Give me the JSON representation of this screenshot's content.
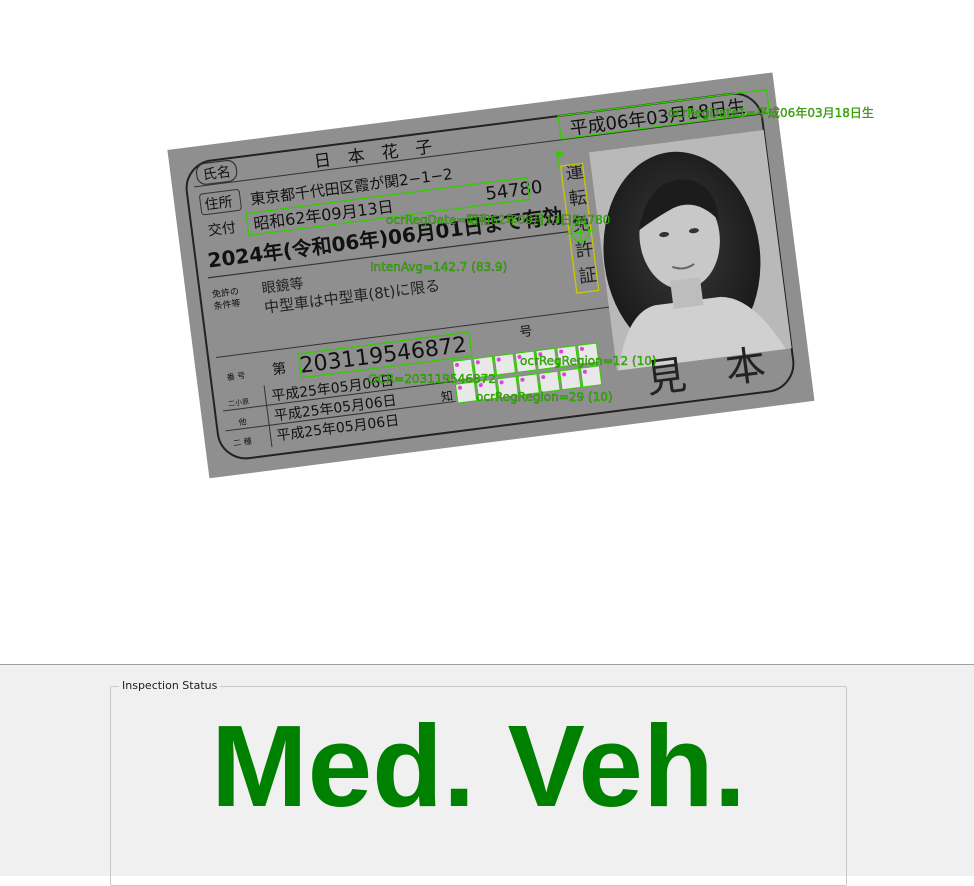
{
  "license": {
    "name_label": "氏名",
    "name_value": "日　本　花　子",
    "birth_date": "平成06年03月18日生",
    "address_label": "住所",
    "address_value": "東京都千代田区霞が関2−1−2",
    "issue_label": "交付",
    "issue_date": "昭和62年09月13日",
    "issue_number": "54780",
    "expiry": "2024年(令和06年)06月01日まで有効",
    "conditions_label_1": "免許の",
    "conditions_label_2": "条件等",
    "conditions_1": "眼鏡等",
    "conditions_2": "中型車は中型車(8t)に限る",
    "number_label": "番 号",
    "number_prefix": "第",
    "license_number": "203119546872",
    "number_suffix": "号",
    "category_labels": [
      "二小原",
      "他",
      "二 種"
    ],
    "category_dates": [
      "平成25年05月06日",
      "平成25年05月06日",
      "平成25年05月06日"
    ],
    "grid_label": "知",
    "vertical_title": [
      "運",
      "転",
      "免",
      "許",
      "証"
    ],
    "stamp": "見　本"
  },
  "overlays": {
    "birth_ocr": "ocrRegDate1=平成06年03月18日生",
    "issue_ocr": "ocrRegDate=昭和62年09月13日54780",
    "intensity": "IntenAvg=142.7 (83.9)",
    "ocr_number": "OCR=203119546872",
    "grid_top": "ocrRegRegion=12 (10)",
    "grid_bottom": "ocrRegRegion=29 (10)"
  },
  "status": {
    "legend": "Inspection Status",
    "value": "Med. Veh.",
    "color": "#008000"
  }
}
